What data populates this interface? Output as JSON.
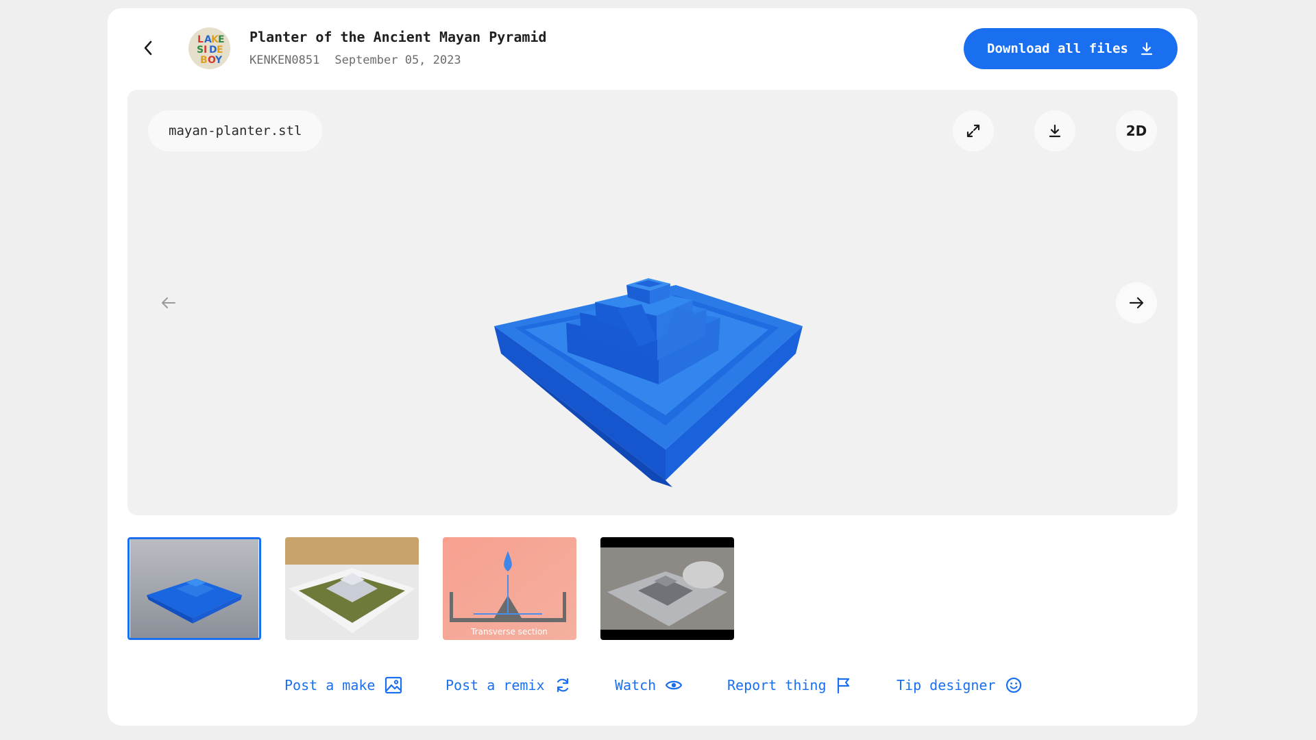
{
  "header": {
    "title": "Planter of the Ancient Mayan Pyramid",
    "author": "KENKEN0851",
    "date": "September 05, 2023",
    "avatar_text": "LAKE SIDE BOY",
    "download_all_label": "Download all files"
  },
  "viewer": {
    "file_name": "mayan-planter.stl",
    "view_mode_label": "2D",
    "model_color": "#1a63e0",
    "icons": [
      "expand-icon",
      "download-icon",
      "2d-toggle-icon",
      "arrow-left-icon",
      "arrow-right-icon"
    ]
  },
  "thumbnails": [
    {
      "name": "render-3d",
      "selected": true
    },
    {
      "name": "photo-moss-planter",
      "selected": false
    },
    {
      "name": "transverse-section",
      "caption": "Transverse section",
      "selected": false
    },
    {
      "name": "video-frame",
      "selected": false
    }
  ],
  "actions": [
    {
      "label": "Post a make",
      "icon": "image-icon"
    },
    {
      "label": "Post a remix",
      "icon": "refresh-icon"
    },
    {
      "label": "Watch",
      "icon": "eye-icon"
    },
    {
      "label": "Report thing",
      "icon": "flag-icon"
    },
    {
      "label": "Tip designer",
      "icon": "smile-icon"
    }
  ],
  "colors": {
    "accent": "#1a6ff0",
    "page_background": "#efefef",
    "viewer_background": "#f1f1f1"
  }
}
